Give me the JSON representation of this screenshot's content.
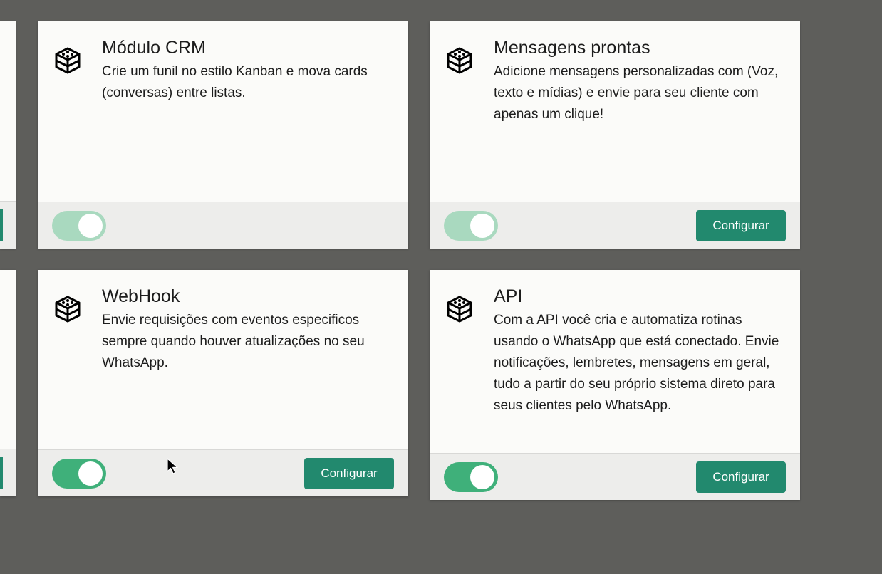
{
  "colors": {
    "background": "#5e5e5b",
    "card": "#fbfbf9",
    "footer": "#ededeb",
    "accent": "#22896e",
    "toggle_on": "#3fb07a",
    "toggle_faded": "#a9d9bf"
  },
  "cards": [
    {
      "icon": "module-blocks-icon",
      "title": "Módulo CRM",
      "description": "Crie um funil no estilo Kanban e mova cards (conversas) entre listas.",
      "toggle": "on-faded",
      "button_label": ""
    },
    {
      "icon": "module-blocks-icon",
      "title": "Mensagens prontas",
      "description": "Adicione mensagens personalizadas com (Voz, texto e mídias) e envie para seu cliente com apenas um clique!",
      "toggle": "on-faded",
      "button_label": "Configurar"
    },
    {
      "icon": "module-blocks-icon",
      "title": "WebHook",
      "description": "Envie requisições com eventos especificos sempre quando houver atualizações no seu WhatsApp.",
      "toggle": "on",
      "button_label": "Configurar"
    },
    {
      "icon": "module-blocks-icon",
      "title": "API",
      "description": "Com a API você cria e automatiza rotinas usando o WhatsApp que está conectado. Envie notificações, lembretes, mensagens em geral, tudo a partir do seu próprio sistema direto para seus clientes pelo WhatsApp.",
      "toggle": "on",
      "button_label": "Configurar"
    }
  ]
}
